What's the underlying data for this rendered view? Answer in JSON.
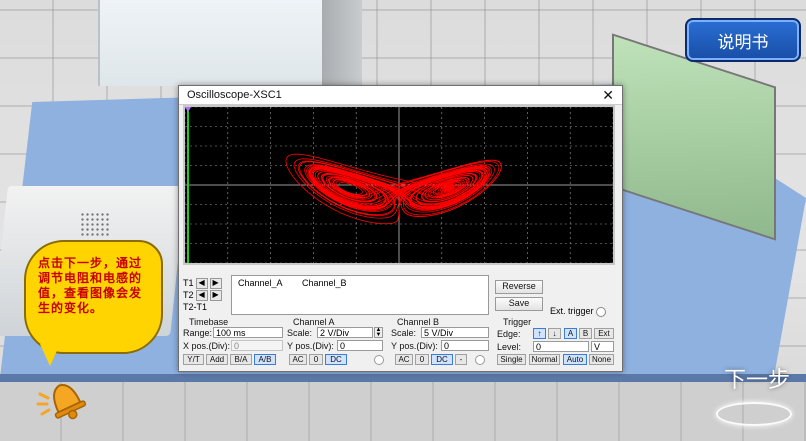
{
  "app": {
    "manual_button": "说明书",
    "next_step": "下一步",
    "hint_text": "点击下一步，通过调节电阻和电感的值，查看图像会发生的变化。",
    "bell_icon": "bell-icon"
  },
  "oscilloscope": {
    "title": "Oscilloscope-XSC1",
    "close_label": "✕",
    "trace_color": "#ff0000",
    "readout": {
      "t1_label": "T1",
      "t2_label": "T2",
      "t2t1_label": "T2-T1",
      "ch_a_header": "Channel_A",
      "ch_b_header": "Channel_B"
    },
    "reverse_label": "Reverse",
    "save_label": "Save",
    "ext_trigger_label": "Ext. trigger",
    "timebase": {
      "title": "Timebase",
      "scale_label": "Range:",
      "scale_value": "100 ms",
      "xpos_label": "X pos.(Div):",
      "xpos_value": "0",
      "buttons": [
        "Y/T",
        "Add",
        "B/A",
        "A/B"
      ]
    },
    "channel_a": {
      "title": "Channel A",
      "scale_label": "Scale:",
      "scale_value": "2  V/Div",
      "ypos_label": "Y pos.(Div):",
      "ypos_value": "0",
      "buttons": [
        "AC",
        "0",
        "DC"
      ]
    },
    "channel_b": {
      "title": "Channel B",
      "scale_label": "Scale:",
      "scale_value": "5  V/Div",
      "ypos_label": "Y pos.(Div):",
      "ypos_value": "0",
      "buttons": [
        "AC",
        "0",
        "DC",
        "-"
      ]
    },
    "trigger": {
      "title": "Trigger",
      "edge_label": "Edge:",
      "edge_buttons": [
        "↑",
        "↓",
        "A",
        "B",
        "Ext"
      ],
      "level_label": "Level:",
      "level_value": "0",
      "level_unit": "V",
      "mode_buttons": [
        "Single",
        "Normal",
        "Auto",
        "None"
      ]
    }
  }
}
